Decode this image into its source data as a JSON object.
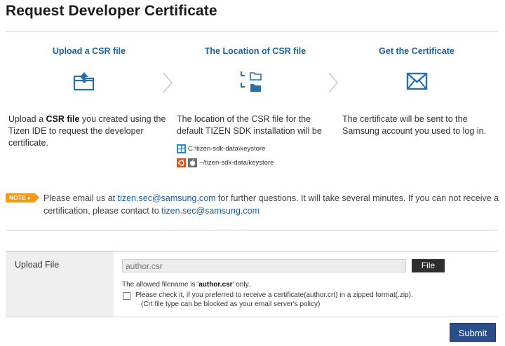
{
  "page": {
    "title": "Request Developer Certificate"
  },
  "steps": [
    {
      "title": "Upload a CSR file",
      "desc_pre": "Upload a ",
      "desc_bold": "CSR file",
      "desc_post": " you created using the Tizen IDE to request the developer certificate."
    },
    {
      "title": "The Location of CSR file",
      "desc": "The location of the CSR file for the default TIZEN SDK installation will be"
    },
    {
      "title": "Get the Certificate",
      "desc": "The certificate will be sent to the Samsung account you used to log in."
    }
  ],
  "paths": {
    "windows": "C:\\tizen-sdk-data\\keystore",
    "unix": "~/tizen-sdk-data/keystore"
  },
  "note": {
    "badge": "NOTE",
    "text1": "Please email us at ",
    "email1": "tizen.sec@samsung.com",
    "text2": " for further questions. It will take several minutes. If you can not receive a certification, please contact to ",
    "email2": "tizen.sec@samsung.com"
  },
  "form": {
    "label": "Upload File",
    "file_placeholder": "author.csr",
    "file_button": "File",
    "hint_pre": "The allowed filename is '",
    "hint_bold": "author.csr",
    "hint_post": "' only.",
    "checkbox_line1": "Please check it, if you preferred to receive a certificate(author.crt) in a zipped format(.zip).",
    "checkbox_line2": "(Crt file type can be blocked as your email server's policy)",
    "checkbox_checked": false
  },
  "submit_label": "Submit",
  "colors": {
    "link": "#1d5f9e",
    "note_badge": "#f39a1d",
    "submit": "#2b4d8a"
  }
}
